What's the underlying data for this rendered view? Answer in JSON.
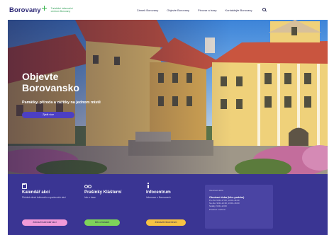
{
  "header": {
    "logo_text": "Borovany",
    "logo_tagline": "Turistické informační centrum Borovany",
    "nav": [
      "Zámek Borovany",
      "Objevte Borovany",
      "Pivovar a trasy",
      "Kontaktujte Borovany"
    ]
  },
  "hero": {
    "title": "Objevte Borovansko",
    "subtitle": "Památky, příroda a zážitky na jednom místě",
    "button_label": "Zjistit více"
  },
  "cards": [
    {
      "icon": "calendar-icon",
      "title": "Kalendář akcí",
      "description": "Přehled všech kulturních a sportovních akcí",
      "button_label": "Zobrazit kalendář akcí",
      "button_color": "#f19ad7"
    },
    {
      "icon": "bike-icon",
      "title": "Prašinky Klášterní",
      "description": "Info o trase",
      "button_label": "Info o trasách",
      "button_color": "#7ed35a"
    },
    {
      "icon": "info-icon",
      "title": "Infocentrum",
      "description": "Informace o Borovanech",
      "button_label": "Zobrazit infocentrum",
      "button_color": "#f6c243"
    }
  ],
  "hours": {
    "label": "Otevírací doba",
    "heading": "Otevírací doba (léto–podzim)",
    "lines": [
      "Po–Pá: 9:00–17:00, 13:00–16:00",
      "So–Ne: 9:00–12:00, 13:00–16:00",
      "Svátky: 9:00–12:00",
      "Prosinec: zavřeno"
    ]
  },
  "colors": {
    "brand": "#2f2a77",
    "band": "#3a3593",
    "accent": "#4c3fc2",
    "logo_green": "#35b34a"
  }
}
